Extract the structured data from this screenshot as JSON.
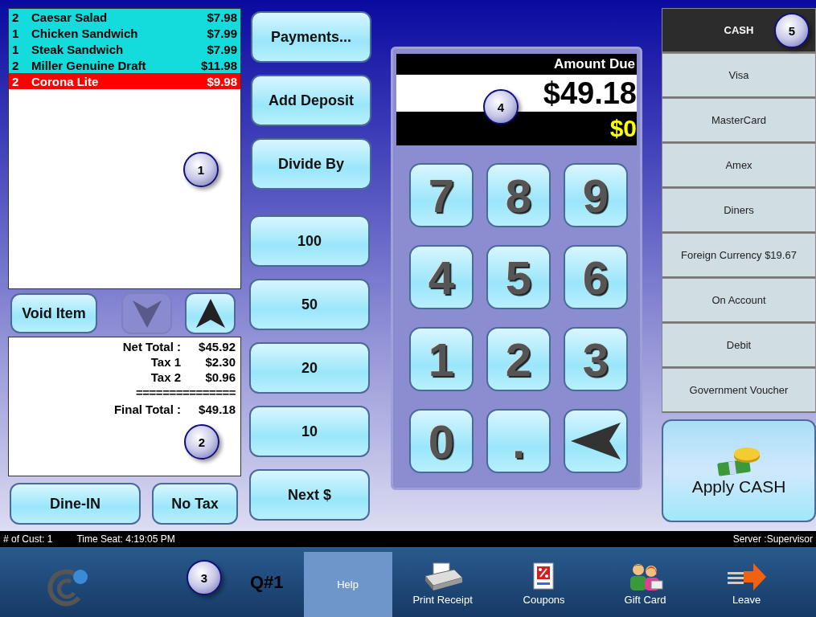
{
  "order_items": [
    {
      "qty": "2",
      "name": "Caesar Salad",
      "price": "$7.98",
      "selected": false
    },
    {
      "qty": "1",
      "name": "Chicken Sandwich",
      "price": "$7.99",
      "selected": false
    },
    {
      "qty": "1",
      "name": "Steak Sandwich",
      "price": "$7.99",
      "selected": false
    },
    {
      "qty": "2",
      "name": "Miller Genuine Draft",
      "price": "$11.98",
      "selected": false
    },
    {
      "qty": "2",
      "name": "Corona Lite",
      "price": "$9.98",
      "selected": true
    }
  ],
  "void_button": "Void Item",
  "scroll_buttons": [
    {
      "kind": "down",
      "disabled": true
    },
    {
      "kind": "up",
      "disabled": false
    }
  ],
  "totals": [
    {
      "kind": "line",
      "label": "Net Total :",
      "value": "$45.92"
    },
    {
      "kind": "line",
      "label": "Tax 1",
      "value": "$2.30"
    },
    {
      "kind": "line",
      "label": "Tax 2",
      "value": "$0.96"
    },
    {
      "kind": "rule",
      "label": "==============="
    },
    {
      "kind": "line",
      "label": "Final Total :",
      "value": "$49.18"
    }
  ],
  "order_type_buttons": [
    "Dine-IN",
    "No Tax"
  ],
  "action_buttons": [
    "Payments...",
    "Add Deposit",
    "Divide By",
    "100",
    "50",
    "20",
    "10",
    "Next $"
  ],
  "display": {
    "title": "Amount Due",
    "amount": "$49.18",
    "tendered": "$0"
  },
  "keypad": [
    {
      "kind": "key",
      "label": "7"
    },
    {
      "kind": "key",
      "label": "8"
    },
    {
      "kind": "key",
      "label": "9"
    },
    {
      "kind": "key",
      "label": "4"
    },
    {
      "kind": "key",
      "label": "5"
    },
    {
      "kind": "key",
      "label": "6"
    },
    {
      "kind": "key",
      "label": "1"
    },
    {
      "kind": "key",
      "label": "2"
    },
    {
      "kind": "key",
      "label": "3"
    },
    {
      "kind": "key",
      "label": "0"
    },
    {
      "kind": "key",
      "label": "."
    },
    {
      "kind": "backspace"
    }
  ],
  "tender_types": [
    {
      "label": "CASH",
      "selected": true
    },
    {
      "label": "Visa",
      "selected": false
    },
    {
      "label": "MasterCard",
      "selected": false
    },
    {
      "label": "Amex",
      "selected": false
    },
    {
      "label": "Diners",
      "selected": false
    },
    {
      "label": "Foreign Currency $19.67",
      "selected": false
    },
    {
      "label": "On Account",
      "selected": false
    },
    {
      "label": "Debit",
      "selected": false
    },
    {
      "label": "Government Voucher",
      "selected": false
    }
  ],
  "apply_button": "Apply CASH",
  "status_bar": {
    "customers": "# of Cust: 1",
    "time_seat": "Time Seat: 4:19:05 PM",
    "server": "Server :Supervisor"
  },
  "bottom_bar": {
    "queue": "Q#1",
    "items": [
      {
        "kind": "help",
        "label": "Help"
      },
      {
        "kind": "printer",
        "label": "Print Receipt"
      },
      {
        "kind": "coupon",
        "label": "Coupons"
      },
      {
        "kind": "people",
        "label": "Gift Card"
      },
      {
        "kind": "exit",
        "label": "Leave"
      }
    ]
  },
  "callouts": [
    "1",
    "2",
    "3",
    "4",
    "5"
  ]
}
